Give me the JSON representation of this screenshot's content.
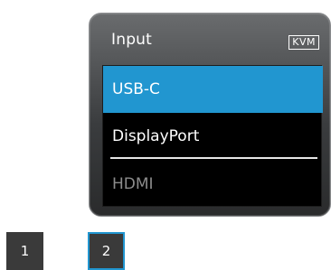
{
  "osd": {
    "title": "Input",
    "badge": "KVM",
    "items": [
      {
        "label": "USB-C",
        "state": "highlighted"
      },
      {
        "label": "DisplayPort",
        "state": "active"
      },
      {
        "label": "HDMI",
        "state": "dimmed"
      }
    ]
  },
  "keys": [
    {
      "label": "1"
    },
    {
      "label": "2",
      "selected": true
    }
  ],
  "colors": {
    "highlight": "#2196d0",
    "panel": "#4a4c4e",
    "list_background": "#000000",
    "dimmed_text": "#8c8c8c"
  }
}
